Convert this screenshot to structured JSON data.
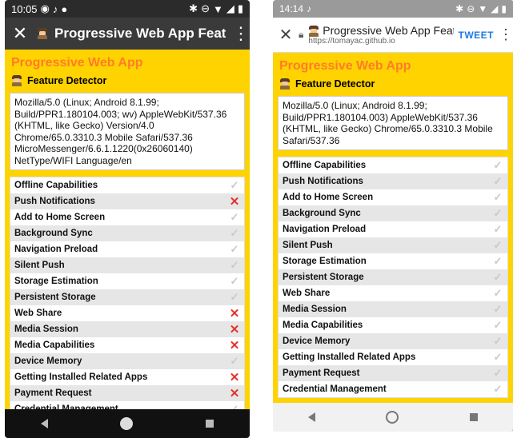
{
  "left": {
    "status": {
      "time": "10:05",
      "icons_left": [
        "target-icon",
        "tiktok-icon",
        "dot-icon"
      ],
      "icons_right": [
        "bluetooth-icon",
        "dnd-icon",
        "wifi-icon",
        "signal-icon",
        "battery-icon"
      ]
    },
    "toolbar": {
      "close": "✕",
      "title": "Progressive Web App Feature D...",
      "menu": "⋮"
    },
    "app_title": "Progressive Web App",
    "subtitle": "Feature Detector",
    "user_agent": "Mozilla/5.0 (Linux; Android 8.1.99; Build/PPR1.180104.003; wv) AppleWebKit/537.36 (KHTML, like Gecko) Version/4.0 Chrome/65.0.3310.3 Mobile Safari/537.36 MicroMessenger/6.6.1.1220(0x26060140) NetType/WIFI Language/en",
    "features": [
      {
        "name": "Offline Capabilities",
        "status": "yes"
      },
      {
        "name": "Push Notifications",
        "status": "no"
      },
      {
        "name": "Add to Home Screen",
        "status": "yes"
      },
      {
        "name": "Background Sync",
        "status": "yes"
      },
      {
        "name": "Navigation Preload",
        "status": "yes"
      },
      {
        "name": "Silent Push",
        "status": "yes"
      },
      {
        "name": "Storage Estimation",
        "status": "yes"
      },
      {
        "name": "Persistent Storage",
        "status": "yes"
      },
      {
        "name": "Web Share",
        "status": "no"
      },
      {
        "name": "Media Session",
        "status": "no"
      },
      {
        "name": "Media Capabilities",
        "status": "no"
      },
      {
        "name": "Device Memory",
        "status": "yes"
      },
      {
        "name": "Getting Installed Related Apps",
        "status": "no"
      },
      {
        "name": "Payment Request",
        "status": "no"
      },
      {
        "name": "Credential Management",
        "status": "yes"
      }
    ]
  },
  "right": {
    "status": {
      "time": "14:14",
      "icons_left": [
        "tiktok-icon"
      ],
      "icons_right": [
        "bluetooth-icon",
        "dnd-icon",
        "wifi-icon",
        "signal-icon",
        "battery-icon"
      ]
    },
    "toolbar": {
      "close": "✕",
      "title": "Progressive Web App Feat...",
      "url": "https://tomayac.github.io",
      "action": "TWEET",
      "menu": "⋮"
    },
    "app_title": "Progressive Web App",
    "subtitle": "Feature Detector",
    "user_agent": "Mozilla/5.0 (Linux; Android 8.1.99; Build/PPR1.180104.003) AppleWebKit/537.36 (KHTML, like Gecko) Chrome/65.0.3310.3 Mobile Safari/537.36",
    "features": [
      {
        "name": "Offline Capabilities",
        "status": "yes"
      },
      {
        "name": "Push Notifications",
        "status": "yes"
      },
      {
        "name": "Add to Home Screen",
        "status": "yes"
      },
      {
        "name": "Background Sync",
        "status": "yes"
      },
      {
        "name": "Navigation Preload",
        "status": "yes"
      },
      {
        "name": "Silent Push",
        "status": "yes"
      },
      {
        "name": "Storage Estimation",
        "status": "yes"
      },
      {
        "name": "Persistent Storage",
        "status": "yes"
      },
      {
        "name": "Web Share",
        "status": "yes"
      },
      {
        "name": "Media Session",
        "status": "yes"
      },
      {
        "name": "Media Capabilities",
        "status": "yes"
      },
      {
        "name": "Device Memory",
        "status": "yes"
      },
      {
        "name": "Getting Installed Related Apps",
        "status": "yes"
      },
      {
        "name": "Payment Request",
        "status": "yes"
      },
      {
        "name": "Credential Management",
        "status": "yes"
      }
    ]
  },
  "marks": {
    "yes": "✓",
    "no": "✕"
  },
  "colors": {
    "accent_orange": "#ff7c2a",
    "page_yellow": "#fed300",
    "cross_red": "#e63030",
    "check_gray": "#c9c9c9",
    "tweet_blue": "#1f7ae0"
  }
}
